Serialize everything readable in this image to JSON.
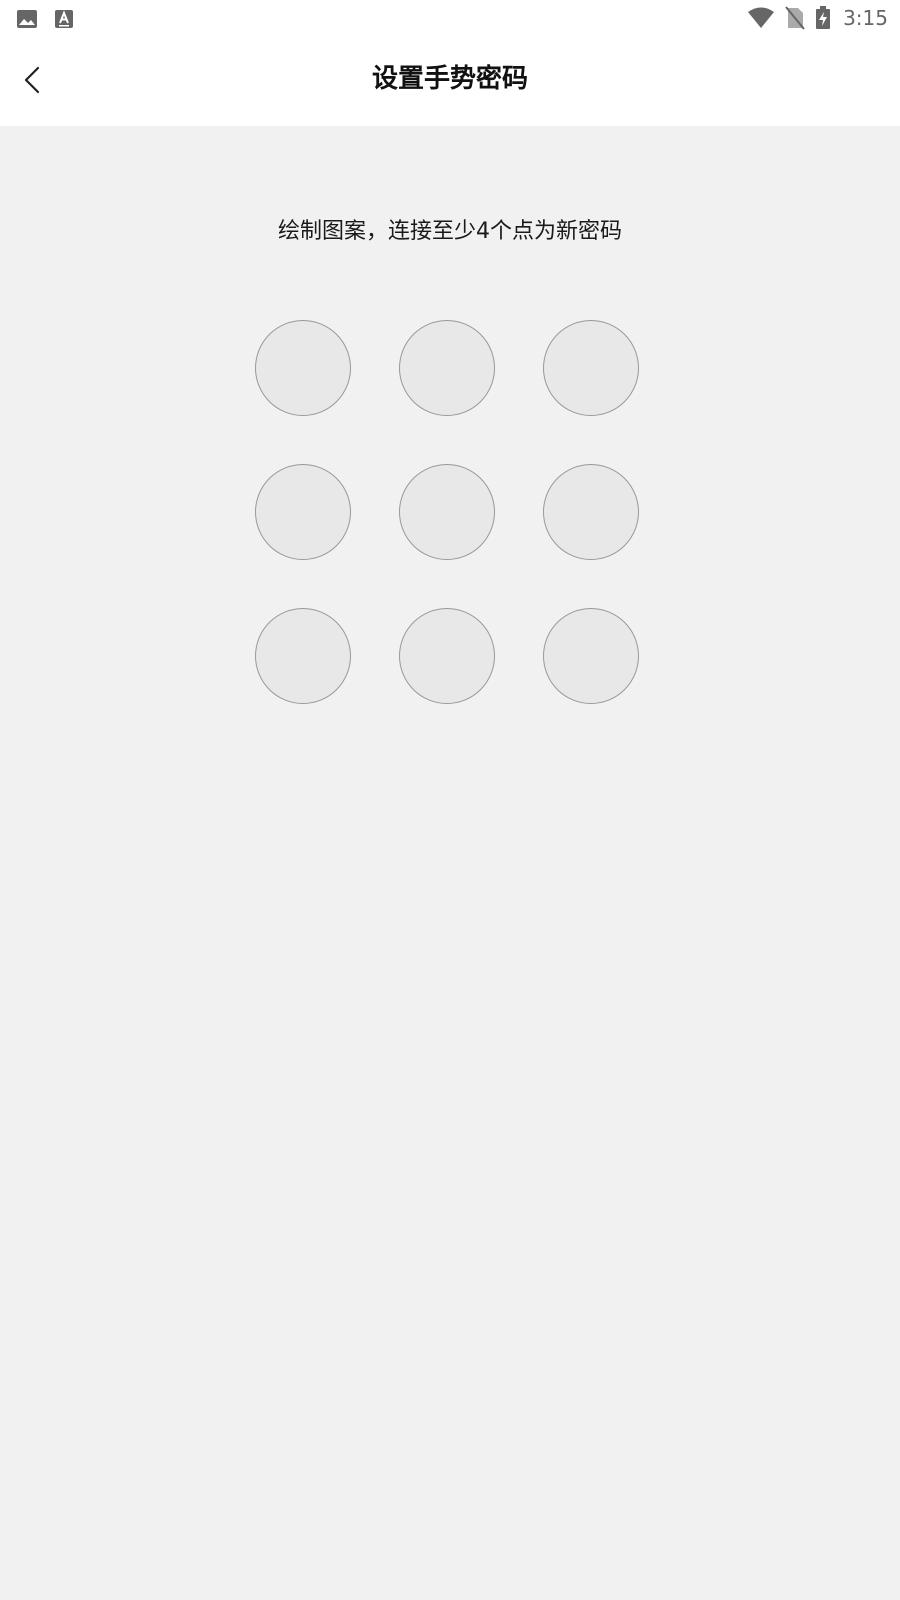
{
  "status_bar": {
    "time": "3:15",
    "left_icons": [
      "image-icon",
      "font-a-icon"
    ],
    "right_icons": [
      "wifi-icon",
      "no-sim-icon",
      "battery-charging-icon"
    ]
  },
  "header": {
    "title": "设置手势密码",
    "back_icon": "chevron-left-icon"
  },
  "main": {
    "instruction": "绘制图案，连接至少4个点为新密码",
    "pattern_dots": [
      {
        "id": 1,
        "row": 1,
        "col": 1
      },
      {
        "id": 2,
        "row": 1,
        "col": 2
      },
      {
        "id": 3,
        "row": 1,
        "col": 3
      },
      {
        "id": 4,
        "row": 2,
        "col": 1
      },
      {
        "id": 5,
        "row": 2,
        "col": 2
      },
      {
        "id": 6,
        "row": 2,
        "col": 3
      },
      {
        "id": 7,
        "row": 3,
        "col": 1
      },
      {
        "id": 8,
        "row": 3,
        "col": 2
      },
      {
        "id": 9,
        "row": 3,
        "col": 3
      }
    ]
  },
  "colors": {
    "background": "#f1f1f1",
    "header_bg": "#ffffff",
    "dot_fill": "#e8e8e8",
    "dot_border": "#999999",
    "title_text": "#111111"
  }
}
